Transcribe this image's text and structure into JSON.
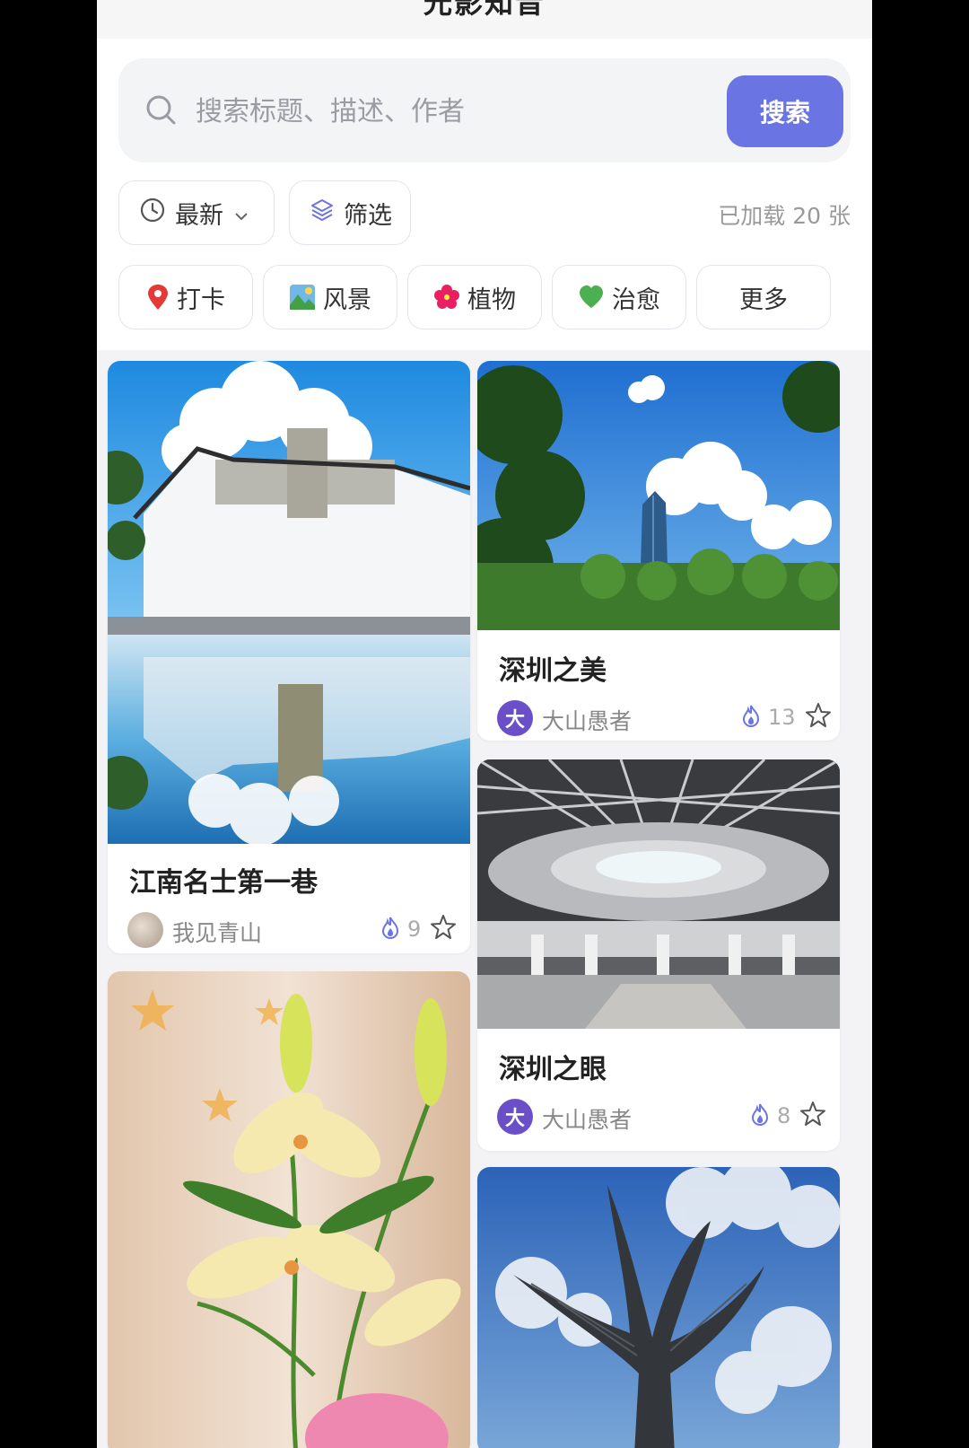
{
  "app": {
    "title": "光影知音"
  },
  "search": {
    "placeholder": "搜索标题、描述、作者",
    "button_label": "搜索"
  },
  "toolbar": {
    "sort_label": "最新",
    "filter_label": "筛选",
    "loaded_text": "已加载 20 张"
  },
  "categories": [
    {
      "emoji": "📍",
      "label": "打卡"
    },
    {
      "emoji": "🏞️",
      "label": "风景"
    },
    {
      "emoji": "🌺",
      "label": "植物"
    },
    {
      "emoji": "💚",
      "label": "治愈"
    },
    {
      "emoji": "",
      "label": "更多"
    }
  ],
  "cards": [
    {
      "title": "江南名士第一巷",
      "author": "我见青山",
      "avatar_text": "",
      "hot_count": "9"
    },
    {
      "title": "深圳之美",
      "author": "大山愚者",
      "avatar_text": "大",
      "hot_count": "13"
    },
    {
      "title": "深圳之眼",
      "author": "大山愚者",
      "avatar_text": "大",
      "hot_count": "8"
    },
    {
      "title": "",
      "author": "",
      "avatar_text": "",
      "hot_count": ""
    },
    {
      "title": "",
      "author": "",
      "avatar_text": "",
      "hot_count": ""
    }
  ],
  "colors": {
    "accent": "#6b74e3",
    "avatar_purple": "#6a4fc9",
    "background": "#f3f3f5"
  }
}
